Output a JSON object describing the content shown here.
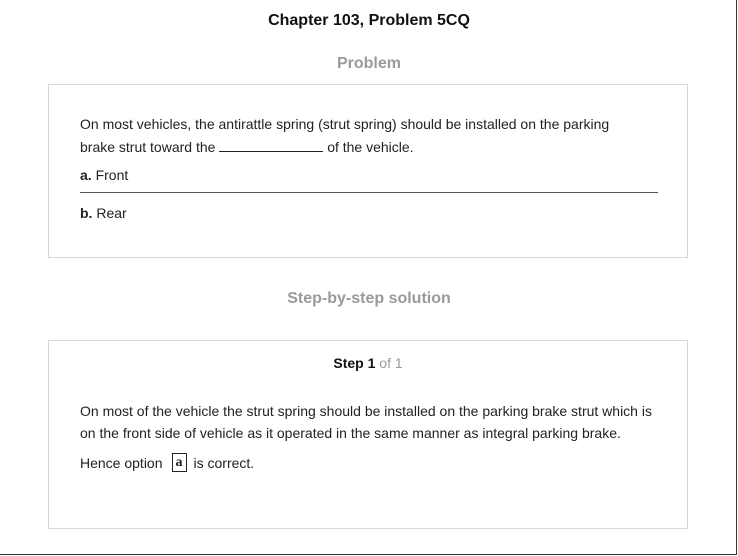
{
  "header": {
    "chapter_title": "Chapter 103, Problem 5CQ"
  },
  "problem": {
    "heading": "Problem",
    "question_part1": "On most vehicles, the antirattle spring (strut spring) should be installed on the parking brake strut toward the",
    "question_part2": "of the vehicle.",
    "options": [
      {
        "letter": "a.",
        "text": "Front"
      },
      {
        "letter": "b.",
        "text": "Rear"
      }
    ]
  },
  "solution": {
    "heading": "Step-by-step solution",
    "step_word": "Step",
    "step_number": "1",
    "step_of": "of 1",
    "explanation": "On most of the vehicle the strut spring should be installed on the parking brake strut which is on the front side of vehicle as it operated in the same manner as integral parking brake.",
    "answer_prefix": "Hence option",
    "answer_letter": "a",
    "answer_suffix": "is correct."
  }
}
